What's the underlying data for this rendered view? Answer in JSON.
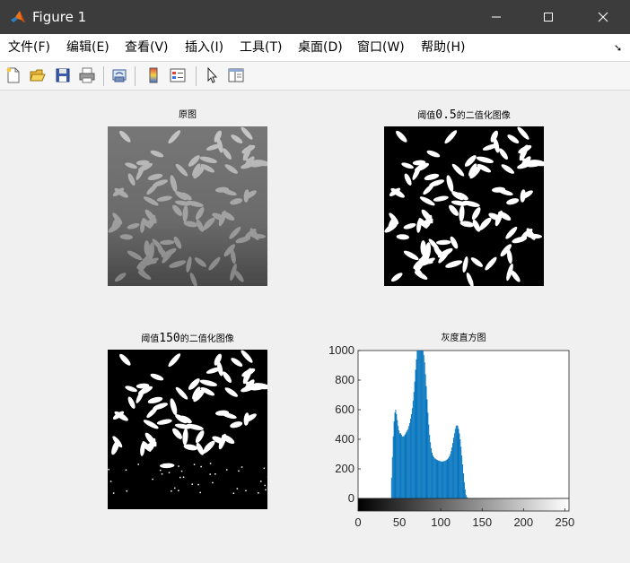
{
  "window": {
    "title": "Figure 1"
  },
  "menu": [
    {
      "label": "文件(F)"
    },
    {
      "label": "编辑(E)"
    },
    {
      "label": "查看(V)"
    },
    {
      "label": "插入(I)"
    },
    {
      "label": "工具(T)"
    },
    {
      "label": "桌面(D)"
    },
    {
      "label": "窗口(W)"
    },
    {
      "label": "帮助(H)"
    }
  ],
  "toolbar": {
    "icons": [
      "new-figure-icon",
      "open-file-icon",
      "save-icon",
      "print-icon",
      "link-plot-icon",
      "insert-colorbar-icon",
      "insert-legend-icon",
      "edit-plot-pointer-icon",
      "property-inspector-icon"
    ]
  },
  "axes": {
    "original": {
      "title": "原图",
      "icon": "rice-grayscale-image"
    },
    "thresh05": {
      "title_prefix": "阈值",
      "title_num": "0.5",
      "title_suffix": "的二值化图像",
      "icon": "rice-binary-image-0.5"
    },
    "thresh150": {
      "title_prefix": "阈值",
      "title_num": "150",
      "title_suffix": "的二值化图像",
      "icon": "rice-binary-image-150"
    },
    "histogram": {
      "title": "灰度直方图"
    }
  },
  "chart_data": {
    "type": "bar",
    "title": "灰度直方图",
    "xlabel": "",
    "ylabel": "",
    "xlim": [
      0,
      255
    ],
    "ylim": [
      0,
      1000
    ],
    "x_ticks": [
      "0",
      "50",
      "100",
      "150",
      "200",
      "250"
    ],
    "y_ticks": [
      "0",
      "200",
      "400",
      "600",
      "800",
      "1000"
    ],
    "colorbar": "grayscale 0-255 below x axis",
    "bar_color": "#0072bd",
    "bins": [
      0,
      0,
      0,
      0,
      0,
      0,
      0,
      0,
      0,
      0,
      0,
      0,
      0,
      0,
      0,
      0,
      0,
      0,
      0,
      0,
      0,
      0,
      0,
      0,
      0,
      0,
      0,
      0,
      0,
      0,
      0,
      0,
      0,
      0,
      0,
      0,
      0,
      0,
      0,
      0,
      140,
      280,
      420,
      520,
      580,
      600,
      570,
      530,
      490,
      460,
      440,
      440,
      430,
      420,
      420,
      420,
      430,
      440,
      450,
      460,
      470,
      490,
      510,
      540,
      570,
      610,
      660,
      720,
      790,
      870,
      940,
      1000,
      1000,
      1000,
      1000,
      1000,
      1000,
      1000,
      1000,
      970,
      920,
      840,
      760,
      670,
      580,
      500,
      430,
      380,
      340,
      310,
      290,
      280,
      270,
      270,
      265,
      260,
      258,
      255,
      255,
      252,
      250,
      250,
      250,
      252,
      253,
      255,
      258,
      262,
      268,
      275,
      285,
      300,
      320,
      345,
      375,
      410,
      440,
      470,
      490,
      495,
      490,
      470,
      440,
      400,
      350,
      290,
      230,
      170,
      110,
      60,
      25,
      10,
      5,
      0,
      0,
      0,
      0,
      0,
      0,
      0,
      0,
      0,
      0,
      0,
      0,
      0,
      0,
      0,
      0,
      0,
      0,
      0,
      0,
      0,
      0,
      0,
      0,
      0,
      0,
      0,
      0,
      0,
      0,
      0,
      0,
      0,
      0,
      0,
      0,
      0,
      0,
      0,
      0,
      0,
      0,
      0,
      0,
      0,
      0,
      0,
      0,
      0,
      0,
      0,
      0,
      0,
      0,
      0,
      0,
      0,
      0,
      0,
      0,
      0,
      0,
      0,
      0,
      0,
      0,
      0,
      0,
      0,
      0,
      0,
      0,
      0,
      0,
      0,
      0,
      0,
      0,
      0,
      0,
      0,
      0,
      0,
      0,
      0,
      0,
      0,
      0,
      0,
      0,
      0,
      0,
      0,
      0,
      0,
      0,
      0,
      0,
      0,
      0,
      0,
      0,
      0,
      0,
      0,
      0,
      0,
      0,
      0,
      0,
      0,
      0,
      0,
      0,
      0,
      0,
      0,
      0,
      0,
      0,
      0,
      0,
      0,
      0,
      0,
      0,
      0,
      0,
      0,
      0,
      0,
      0,
      0,
      0,
      0,
      0,
      0,
      0,
      0,
      0,
      0,
      0,
      0,
      0,
      0,
      0,
      0,
      0,
      0,
      0,
      0,
      0,
      0,
      0,
      0,
      0,
      0,
      0
    ],
    "bin_start": 0
  }
}
